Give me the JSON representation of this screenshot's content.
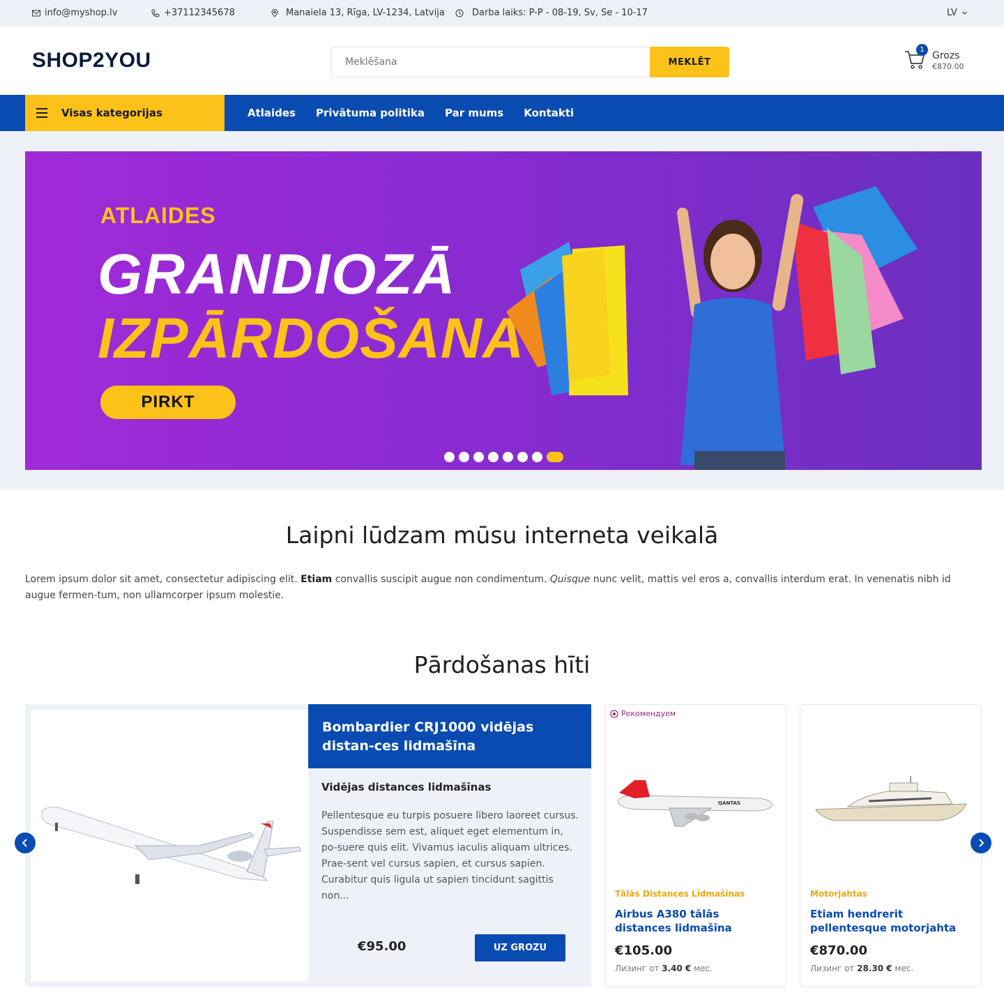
{
  "topbar": {
    "email": "info@myshop.lv",
    "phone": "+37112345678",
    "address": "Manaiela 13, Rīga, LV-1234, Latvija",
    "hours": "Darba laiks: P-P - 08-19, Sv, Se - 10-17",
    "language": "LV"
  },
  "header": {
    "logo": "SHOP2YOU",
    "search_placeholder": "Meklēšana",
    "search_button": "MEKLĒT",
    "cart_count": "1",
    "cart_label": "Grozs",
    "cart_total": "€870.00"
  },
  "nav": {
    "categories_label": "Visas kategorijas",
    "links": [
      "Atlaides",
      "Privātuma politika",
      "Par mums",
      "Kontakti"
    ]
  },
  "hero": {
    "kicker": "ATLAIDES",
    "line1": "GRANDIOZĀ",
    "line2": "IZPĀRDOŠANA",
    "cta": "PIRKT",
    "slide_count": 8,
    "active_slide": 8
  },
  "welcome": {
    "title": "Laipni lūdzam mūsu interneta veikalā",
    "p1": "Lorem ipsum dolor sit amet, consectetur adipiscing elit. ",
    "p_bold": "Etiam",
    "p2": " convallis suscipit augue non condimentum. ",
    "p_italic": "Quisque",
    "p3": " nunc velit, mattis vel eros a, convallis interdum erat. In venenatis nibh id augue fermen-tum, non ullamcorper ipsum molestie."
  },
  "bestsellers": {
    "title": "Pārdošanas hīti",
    "featured": {
      "title": "Bombardier CRJ1000 vidējas distan-ces lidmašīna",
      "subtitle": "Vidējas distances lidmašīnas",
      "description": "Pellentesque eu turpis posuere libero laoreet cursus. Suspendisse sem est, aliquet eget elementum in, po-suere quis elit. Vivamus iaculis aliquam ultrices. Prae-sent vel cursus sapien, et cursus sapien. Curabitur quis ligula ut sapien tincidunt sagittis non...",
      "price": "€95.00",
      "button": "UZ GROZU"
    },
    "cards": [
      {
        "badge": "Рекомендуем",
        "category": "Tālās Distances Lidmašīnas",
        "name": "Airbus A380 tālās distances lidmašīna",
        "price": "€105.00",
        "lease_prefix": "Лизинг от ",
        "lease_amount": "3.40 €",
        "lease_suffix": " мес."
      },
      {
        "badge": "",
        "category": "Motorjahtas",
        "name": "Etiam hendrerit pellentesque motorjahta",
        "price": "€870.00",
        "lease_prefix": "Лизинг от ",
        "lease_amount": "28.30 €",
        "lease_suffix": " мес."
      }
    ]
  },
  "colors": {
    "primary": "#0a4bb1",
    "accent": "#fcc21a",
    "hero_purple": "#8a2bd2"
  }
}
